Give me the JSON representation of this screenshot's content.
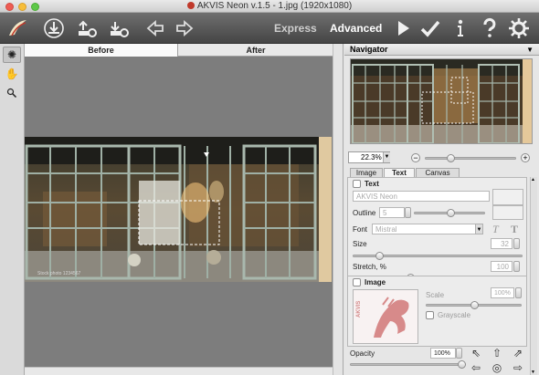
{
  "window": {
    "title": "AKVIS Neon v.1.5 - 1.jpg (1920x1080)"
  },
  "toolbar": {
    "items": [
      {
        "name": "logo-icon"
      },
      {
        "name": "open-file-icon"
      },
      {
        "name": "save-settings-icon"
      },
      {
        "name": "load-settings-icon"
      },
      {
        "name": "back-arrow-icon"
      },
      {
        "name": "forward-arrow-icon"
      }
    ],
    "express_label": "Express",
    "advanced_label": "Advanced",
    "run_icon": "play-icon",
    "apply_icon": "checkmark-icon",
    "info_icon": "info-icon",
    "help_icon": "help-icon",
    "settings_icon": "gear-icon"
  },
  "tools": {
    "items": [
      "neon-tool-icon",
      "hand-icon",
      "zoom-icon"
    ]
  },
  "view_tabs": {
    "before": "Before",
    "after": "After",
    "active": "Before"
  },
  "navigator": {
    "title": "Navigator",
    "zoom_value": "22.3%",
    "zoom_level": 0.25
  },
  "panel_tabs": {
    "image": "Image",
    "text": "Text",
    "canvas": "Canvas",
    "active": "Text"
  },
  "text_group": {
    "title": "Text",
    "text_placeholder": "AKVIS Neon",
    "outline_label": "Outline",
    "outline_value": "5",
    "font_label": "Font",
    "font_value": "Mistral",
    "bold_icon": "italic-t-icon",
    "format_icon": "bold-t-icon",
    "size_label": "Size",
    "size_value": "32",
    "stretch_label": "Stretch, %",
    "stretch_value": "100"
  },
  "image_group": {
    "title": "Image",
    "logo_text": "AKVIS",
    "scale_label": "Scale",
    "scale_value": "100%",
    "grayscale_label": "Grayscale"
  },
  "opacity": {
    "label": "Opacity",
    "value": "100%",
    "level": 1.0
  },
  "align_buttons": [
    "arrow-up-left-icon",
    "arrow-up-icon",
    "arrow-up-right-icon",
    "arrow-left-icon",
    "circle-center-icon",
    "arrow-right-icon"
  ],
  "photo_watermark": "Stock photo 1234567",
  "colors": {
    "toolbar": "#555555",
    "canvas": "#7d7d7d",
    "accent_red": "#c0392b"
  }
}
